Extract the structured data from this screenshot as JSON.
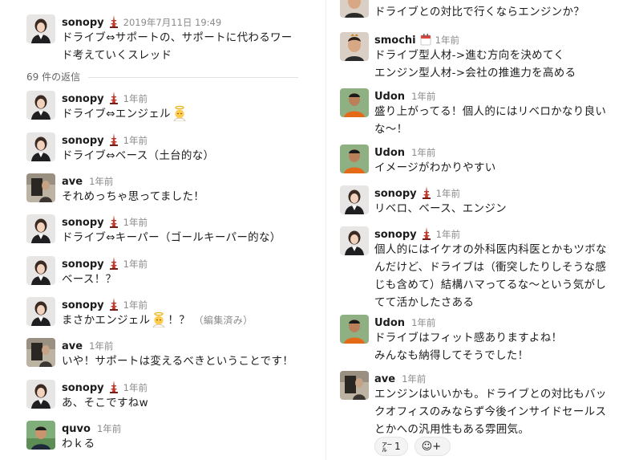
{
  "left_pane": {
    "parent": {
      "author": "sonopy",
      "timestamp": "2019年7月11日 19:49",
      "lines": [
        "ドライブ⇔サポートの、サポートに代わるワー",
        "ド考えていくスレッド"
      ]
    },
    "replies_count_label": "69 件の返信",
    "messages": [
      {
        "author": "sonopy",
        "time": "1年前",
        "line1": "ドライブ⇔エンジェル",
        "avatar": "woman-avatar",
        "inline_emoji": "angel-emoji"
      },
      {
        "author": "sonopy",
        "time": "1年前",
        "line1": "ドライブ⇔ベース（土台的な）",
        "avatar": "woman-avatar"
      },
      {
        "author": "ave",
        "time": "1年前",
        "line1": "それめっちゃ思ってました！",
        "avatar": "ave-avatar"
      },
      {
        "author": "sonopy",
        "time": "1年前",
        "line1": "ドライブ⇔キーパー（ゴールキーパー的な）",
        "avatar": "woman-avatar"
      },
      {
        "author": "sonopy",
        "time": "1年前",
        "line1": "ベース！？",
        "avatar": "woman-avatar"
      },
      {
        "author": "sonopy",
        "time": "1年前",
        "line1": "まさかエンジェル",
        "line1_after": "！？",
        "edited": "（編集済み）",
        "avatar": "woman-avatar",
        "inline_emoji": "angel-emoji"
      },
      {
        "author": "ave",
        "time": "1年前",
        "line1": "いや！サポートは変えるべきということです！",
        "avatar": "ave-avatar"
      },
      {
        "author": "sonopy",
        "time": "1年前",
        "line1": "あ、そこですねw",
        "avatar": "woman-avatar"
      },
      {
        "author": "quvo",
        "time": "1年前",
        "line1": "わｋる",
        "avatar": "quvo-avatar"
      }
    ]
  },
  "right_pane": {
    "top_cut_line": "ドライブとの対比で行くならエンジンか？",
    "messages": [
      {
        "author": "smochi",
        "time": "1年前",
        "lines": [
          "ドライブ型人材->進む方向を決めてく",
          "エンジン型人材->会社の推進力を高める"
        ],
        "avatar": "smochi-avatar"
      },
      {
        "author": "Udon",
        "time": "1年前",
        "lines": [
          "盛り上がってる！個人的にはリベロかなり良い",
          "な〜！"
        ],
        "avatar": "udon-avatar"
      },
      {
        "author": "Udon",
        "time": "1年前",
        "lines": [
          "イメージがわかりやすい"
        ],
        "avatar": "udon-avatar"
      },
      {
        "author": "sonopy",
        "time": "1年前",
        "lines": [
          "リベロ、ベース、エンジン"
        ],
        "avatar": "woman-avatar"
      },
      {
        "author": "sonopy",
        "time": "1年前",
        "lines": [
          "個人的にはイケオの外科医内科医とかもツボな",
          "んだけど、ドライブは（衝突したりしそうな感",
          "じも含めて）結構ハマってるな〜という気がし",
          "てて活かしたさある"
        ],
        "avatar": "woman-avatar"
      },
      {
        "author": "Udon",
        "time": "1年前",
        "lines": [
          "ドライブはフィット感ありますよね！",
          "みんなも納得してそうでした！"
        ],
        "avatar": "udon-avatar"
      },
      {
        "author": "ave",
        "time": "1年前",
        "lines": [
          "エンジンはいいかも。ドライブとの対比もバッ",
          "クオフィスのみならず今後インサイドセールス",
          "とかへの汎用性もある雰囲気。"
        ],
        "avatar": "ave-avatar"
      }
    ],
    "reactions": [
      {
        "glyph": "㌃",
        "count": "1"
      },
      {
        "glyph": "☺+",
        "count": ""
      }
    ]
  },
  "colors": {
    "text": "#1d1c1d",
    "muted": "#8a8a8a",
    "name": "#1d1c1d"
  }
}
